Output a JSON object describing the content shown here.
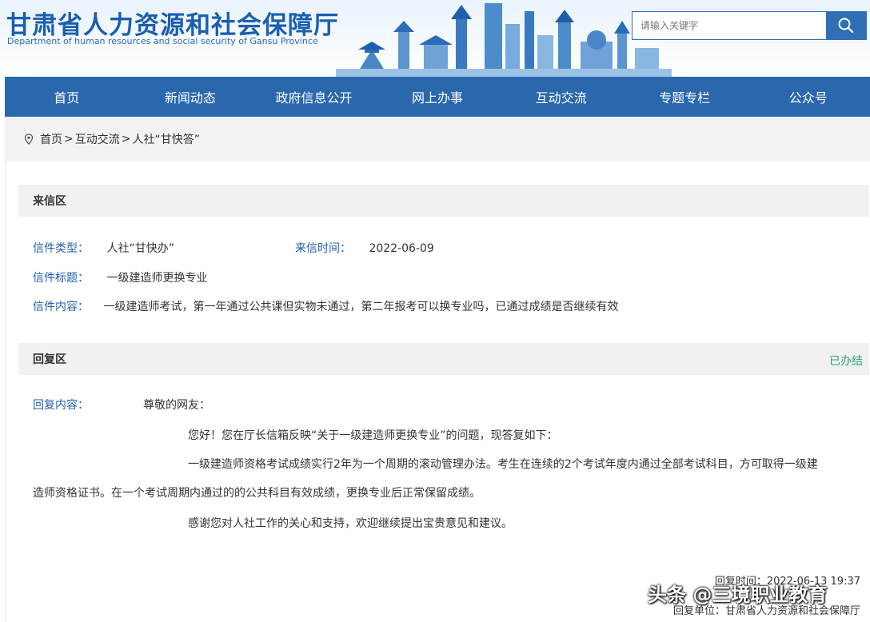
{
  "header": {
    "title": "甘肃省人力资源和社会保障厅",
    "subtitle": "Department of human resources and social security of Gansu Province",
    "search_placeholder": "请输入关键字"
  },
  "nav": [
    "首页",
    "新闻动态",
    "政府信息公开",
    "网上办事",
    "互动交流",
    "专题专栏",
    "公众号"
  ],
  "breadcrumb": {
    "items": [
      "首页",
      "互动交流",
      "人社“甘快答”"
    ],
    "separator": ">"
  },
  "letter": {
    "section_title": "来信区",
    "type_label": "信件类型：",
    "type_value": "人社“甘快办”",
    "time_label": "来信时间：",
    "time_value": "2022-06-09",
    "subject_label": "信件标题：",
    "subject_value": "一级建造师更换专业",
    "content_label": "信件内容：",
    "content_value": "一级建造师考试，第一年通过公共课但实物未通过，第二年报考可以换专业吗，已通过成绩是否继续有效"
  },
  "reply": {
    "section_title": "回复区",
    "status": "已办结",
    "content_label": "回复内容：",
    "salutation": "尊敬的网友：",
    "para1": "您好！您在厅长信箱反映“关于一级建造师更换专业”的问题，现答复如下：",
    "para2_line1": "一级建造师资格考试成绩实行2年为一个周期的滚动管理办法。考生在连续的2个考试年度内通过全部考试科目，方可取得一级建",
    "para2_line2": "造师资格证书。在一个考试周期内通过的的公共科目有效成绩，更换专业后正常保留成绩。",
    "para3": "感谢您对人社工作的关心和支持，欢迎继续提出宝贵意见和建议。",
    "reply_time": "回复时间：2022-06-13 19:37",
    "reply_unit": "回复单位：甘肃省人力资源和社会保障厅"
  },
  "watermark": "头条 @三境职业教育",
  "colors": {
    "nav_bg": "#2a67ad",
    "label_blue": "#1f5fae",
    "status_green": "#2aa36b"
  }
}
